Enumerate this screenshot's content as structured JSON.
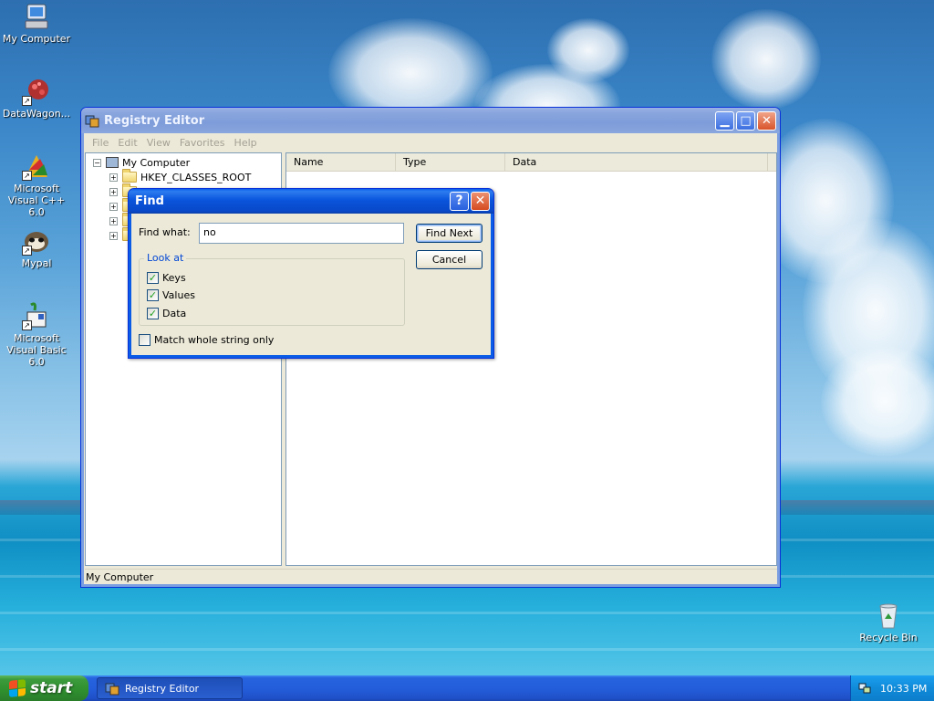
{
  "desktop": {
    "icons": [
      {
        "label": "My Computer"
      },
      {
        "label": "DataWagon..."
      },
      {
        "label": "Microsoft Visual C++ 6.0"
      },
      {
        "label": "Mypal"
      },
      {
        "label": "Microsoft Visual Basic 6.0"
      },
      {
        "label": "Recycle Bin"
      }
    ]
  },
  "registry_editor": {
    "title": "Registry Editor",
    "menu": [
      "File",
      "Edit",
      "View",
      "Favorites",
      "Help"
    ],
    "tree": {
      "root": "My Computer",
      "children": [
        "HKEY_CLASSES_ROOT"
      ]
    },
    "columns": [
      "Name",
      "Type",
      "Data"
    ],
    "status": "My Computer"
  },
  "find_dialog": {
    "title": "Find",
    "find_what_label": "Find what:",
    "find_what_value": "no",
    "find_next_label": "Find Next",
    "cancel_label": "Cancel",
    "look_at_title": "Look at",
    "checkboxes": [
      {
        "label": "Keys",
        "checked": true
      },
      {
        "label": "Values",
        "checked": true
      },
      {
        "label": "Data",
        "checked": true
      }
    ],
    "match_whole_label": "Match whole string only",
    "match_whole_checked": false
  },
  "taskbar": {
    "start_label": "start",
    "task_label": "Registry Editor",
    "clock": "10:33 PM"
  }
}
